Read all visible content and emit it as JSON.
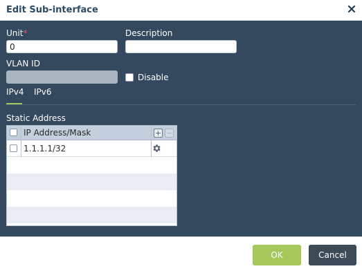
{
  "dialog": {
    "title": "Edit Sub-interface"
  },
  "form": {
    "unit_label": "Unit",
    "required_mark": "*",
    "unit_value": "0",
    "description_label": "Description",
    "description_value": "",
    "vlan_label": "VLAN ID",
    "vlan_value": "",
    "disable_label": "Disable",
    "disable_checked": false
  },
  "tabs": [
    {
      "label": "IPv4",
      "active": true
    },
    {
      "label": "IPv6",
      "active": false
    }
  ],
  "static_address": {
    "label": "Static Address",
    "column_header": "IP Address/Mask",
    "add_symbol": "+",
    "remove_symbol": "−",
    "rows": [
      {
        "ip": "1.1.1.1/32",
        "checked": false,
        "action_icon": "gear-icon"
      }
    ]
  },
  "footer": {
    "ok_label": "OK",
    "cancel_label": "Cancel"
  },
  "colors": {
    "background": "#34495e",
    "accent_green": "#a6c85a",
    "cancel_button": "#3d4a57",
    "title_text": "#2c4a63",
    "required": "#e05757",
    "grid_header": "#c3cfdc"
  }
}
